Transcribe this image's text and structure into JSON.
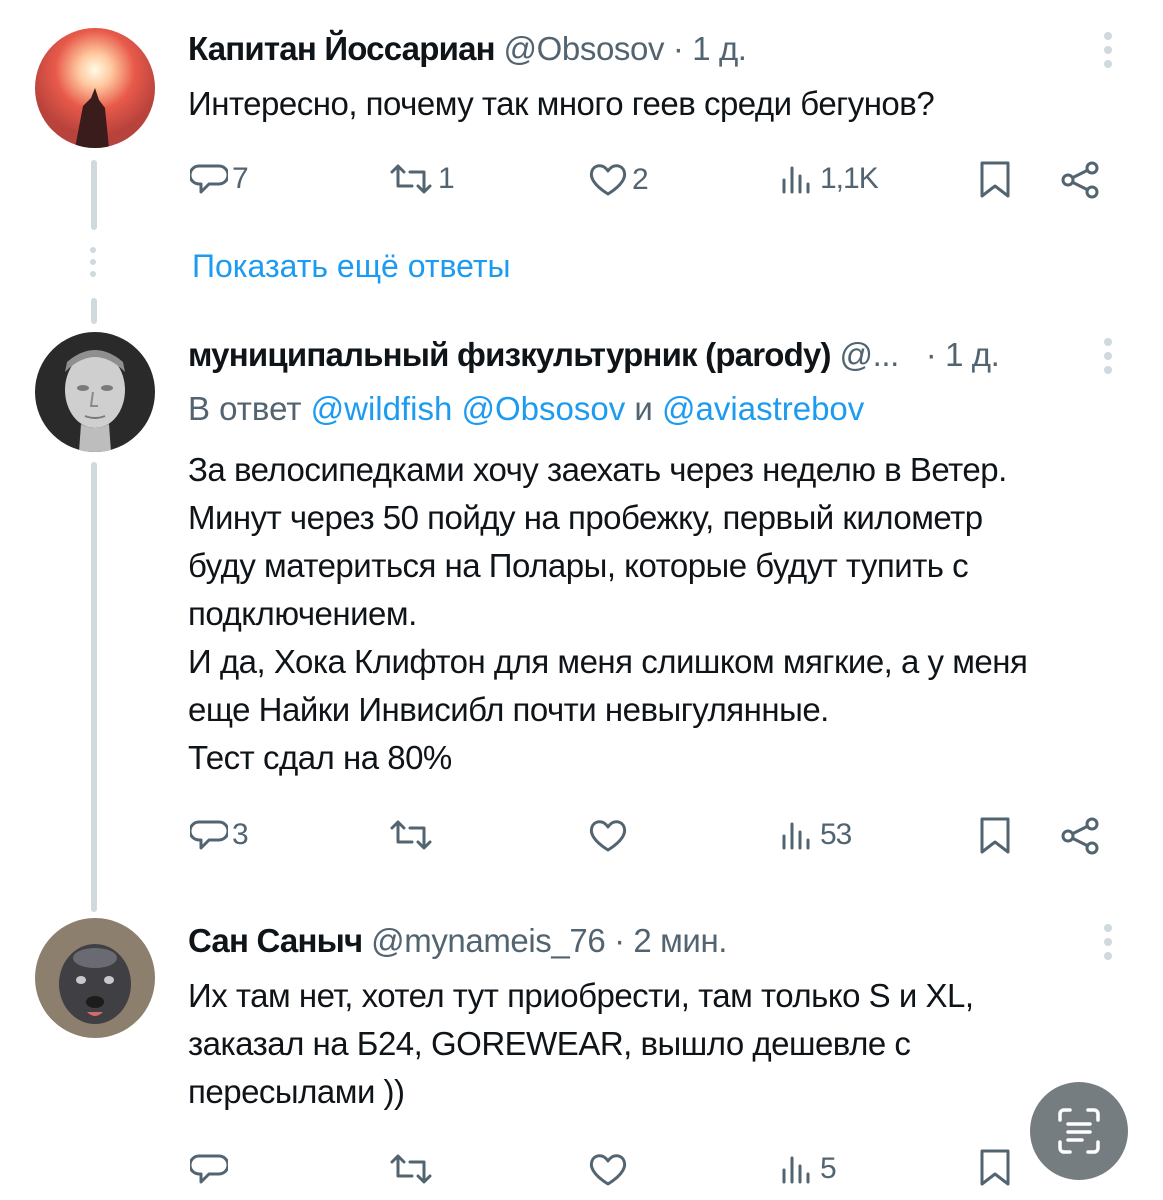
{
  "show_more_label": "Показать ещё ответы",
  "tweets": [
    {
      "name": "Капитан Йоссариан",
      "handle": "@Obsosov",
      "time": "· 1 д.",
      "text": "Интересно, почему так много геев среди бегунов?",
      "reply_count": "7",
      "retweet_count": "1",
      "like_count": "2",
      "view_count": "1,1K"
    },
    {
      "name": "муниципальный физкультурник (parody)",
      "handle": "@...",
      "time": "· 1 д.",
      "reply_prefix": "В ответ",
      "mention1": "@wildfish",
      "mention2": "@Obsosov",
      "reply_and": "и",
      "mention3": "@aviastrebov",
      "text": "За велосипедками хочу заехать через неделю в Ветер.\nМинут через 50 пойду на пробежку, первый километр\nбуду материться на Полары, которые будут тупить с\nподключением.\nИ да, Хока Клифтон для меня слишком мягкие, а у меня\nеще Найки Инвисибл почти невыгулянные.\nТест сдал на 80%",
      "reply_count": "3",
      "view_count": "53"
    },
    {
      "name": "Сан Саныч",
      "handle": "@mynameis_76",
      "time": "· 2 мин.",
      "text": "Их там нет, хотел тут приобрести, там только S и XL,\nзаказал на Б24, GOREWEAR, вышло дешевле с\nпересылами ))",
      "view_count": "5"
    }
  ],
  "colors": {
    "accent": "#1d9bf0",
    "secondary_text": "#536471",
    "thread_line": "#cfd9de"
  }
}
